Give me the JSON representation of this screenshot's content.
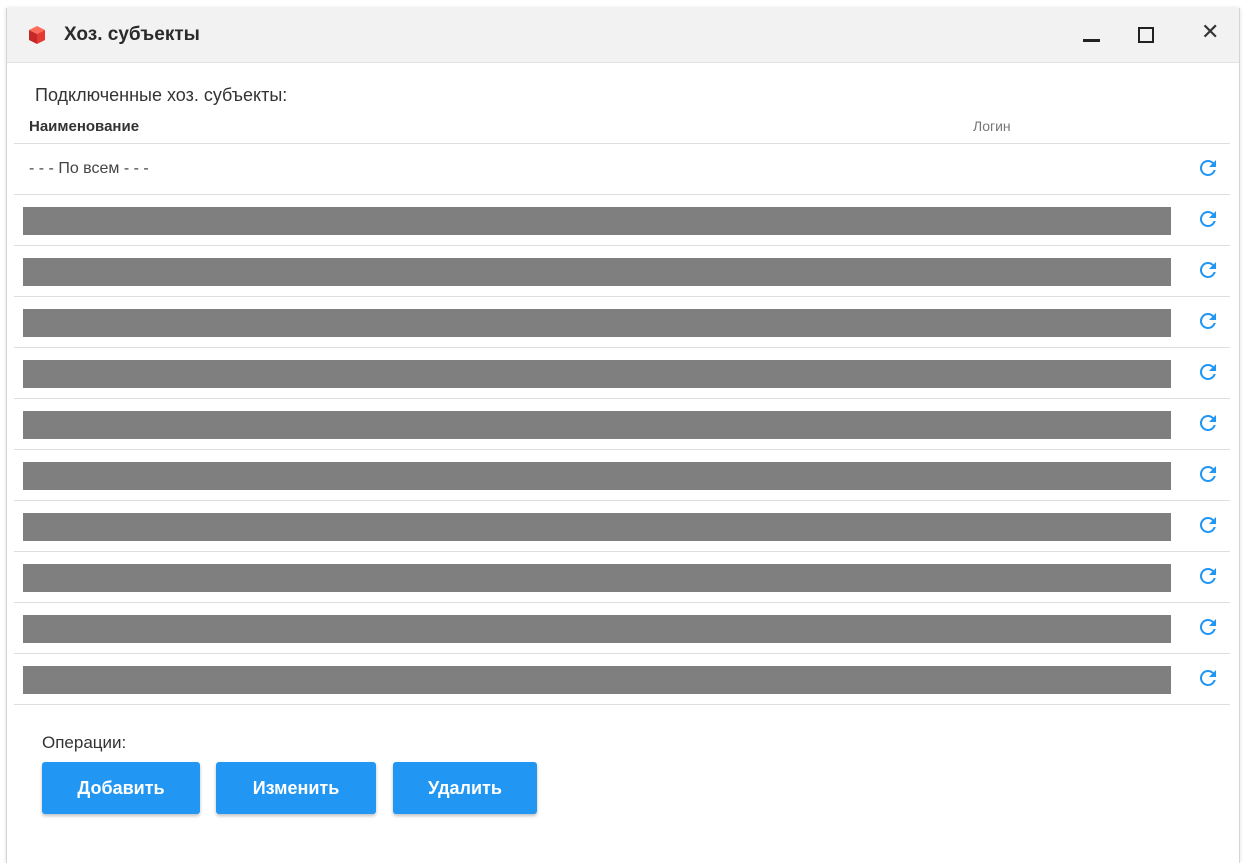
{
  "window": {
    "title": "Хоз. субъекты",
    "close_glyph": "✕"
  },
  "main": {
    "section_label": "Подключенные хоз. субъекты:",
    "columns": [
      "Наименование",
      "Логин"
    ],
    "rows": [
      {
        "name": "- - - По всем - - -",
        "redacted": false
      },
      {
        "name": "",
        "redacted": true
      },
      {
        "name": "",
        "redacted": true
      },
      {
        "name": "",
        "redacted": true
      },
      {
        "name": "",
        "redacted": true
      },
      {
        "name": "",
        "redacted": true
      },
      {
        "name": "",
        "redacted": true
      },
      {
        "name": "",
        "redacted": true
      },
      {
        "name": "",
        "redacted": true
      },
      {
        "name": "",
        "redacted": true
      },
      {
        "name": "",
        "redacted": true
      }
    ]
  },
  "operations": {
    "label": "Операции:",
    "add": "Добавить",
    "edit": "Изменить",
    "delete": "Удалить"
  },
  "colors": {
    "accent": "#2196f3",
    "redaction": "#7f7f7f",
    "refresh_icon": "#2196f3"
  },
  "icons": {
    "app": "red-cube-icon",
    "row_action": "refresh-icon"
  }
}
